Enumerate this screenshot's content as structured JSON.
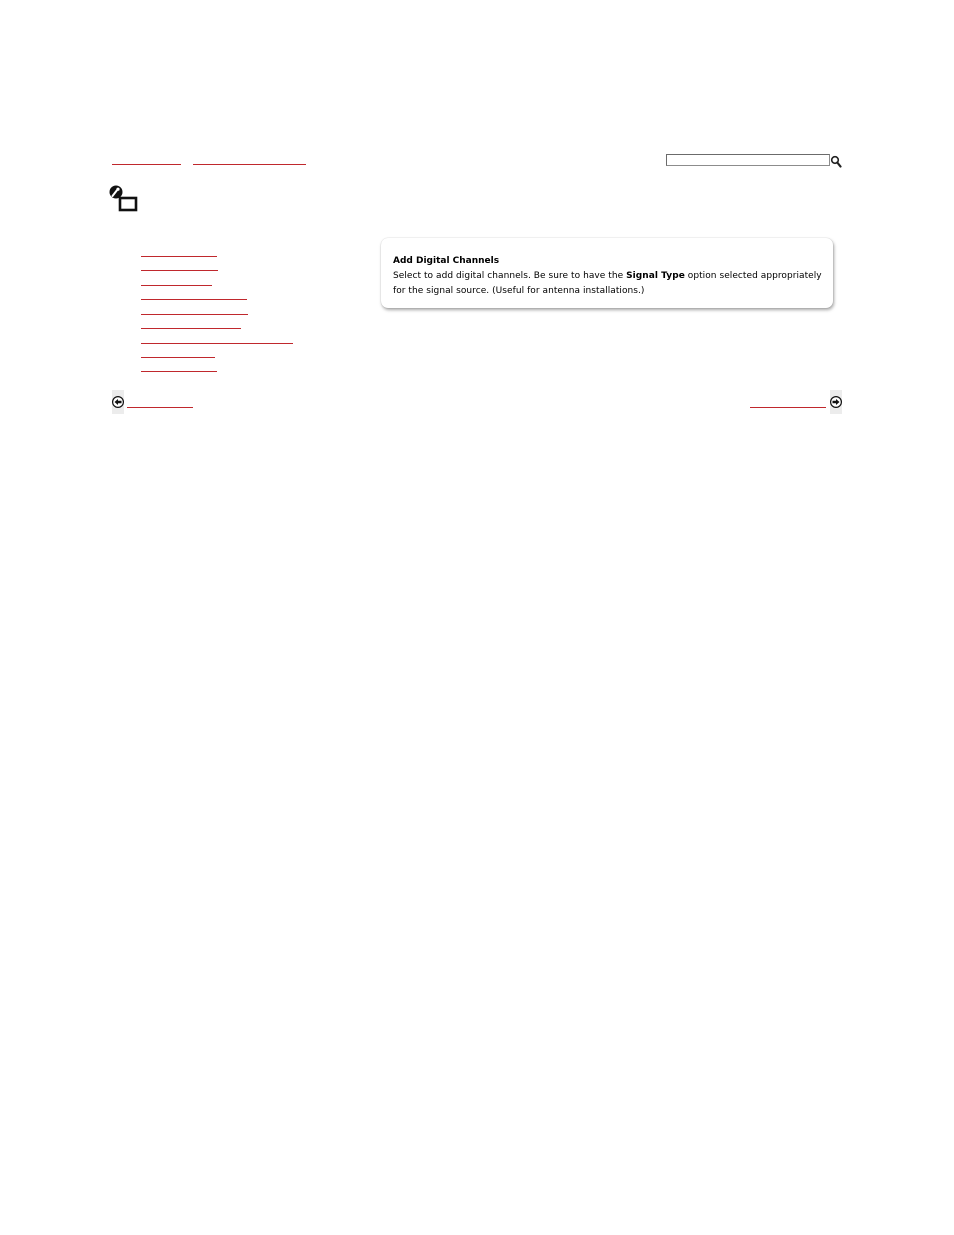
{
  "breadcrumb": {
    "items": [
      "",
      ""
    ]
  },
  "search": {
    "value": "",
    "icon": "magnifier-icon"
  },
  "header": {
    "icon": "settings-icon"
  },
  "sidebar": {
    "items": [
      "",
      "",
      "",
      "",
      "",
      "",
      "",
      "",
      ""
    ]
  },
  "info": {
    "title": "Add Digital Channels",
    "text_before": "Select to add digital channels. Be sure to have the ",
    "text_bold": "Signal Type",
    "text_after": " option selected appropriately for the signal source. (Useful for antenna installations.)"
  },
  "pagination": {
    "prev_label": "",
    "next_label": "",
    "prev_icon": "arrow-left-icon",
    "next_icon": "arrow-right-icon"
  },
  "colors": {
    "link": "#c0282d",
    "box_shadow": "#b0b0b0"
  }
}
